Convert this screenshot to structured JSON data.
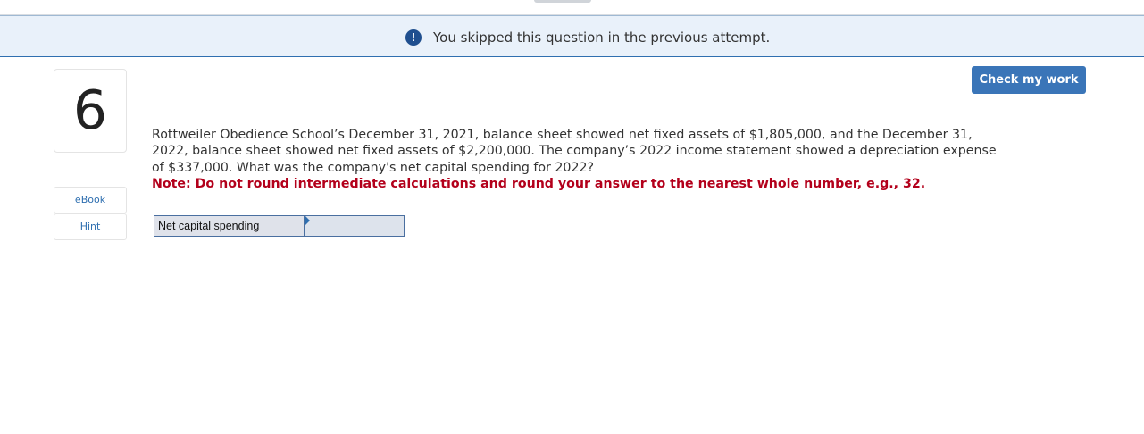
{
  "notice": {
    "icon": "exclamation-circle-icon",
    "text": "You skipped this question in the previous attempt."
  },
  "question_number": "6",
  "sidebar": {
    "ebook_label": "eBook",
    "hint_label": "Hint"
  },
  "check_button_label": "Check my work",
  "question": {
    "body": "Rottweiler Obedience School’s December 31, 2021, balance sheet showed net fixed assets of $1,805,000, and the December 31, 2022, balance sheet showed net fixed assets of $2,200,000. The company’s 2022 income statement showed a depreciation expense of $337,000. What was the company's net capital spending for 2022?",
    "note": "Note: Do not round intermediate calculations and round your answer to the nearest whole number, e.g., 32."
  },
  "answer_table": {
    "label": "Net capital spending",
    "value": ""
  },
  "colors": {
    "accent": "#3a75b8",
    "note": "#b3001b",
    "notice_bg": "#e9f1fa"
  }
}
